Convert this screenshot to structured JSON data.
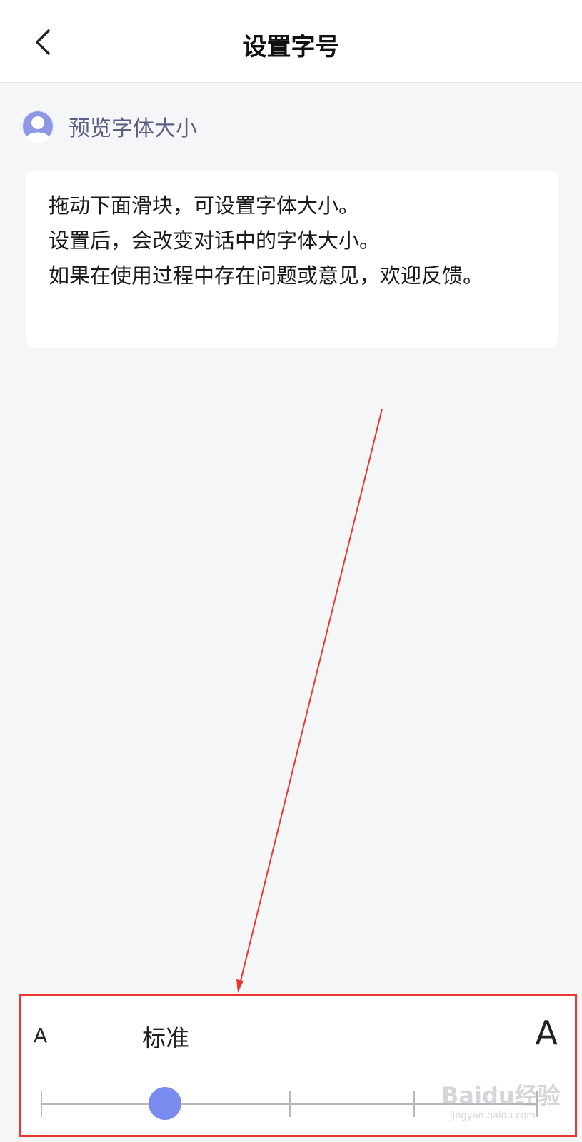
{
  "header": {
    "title": "设置字号"
  },
  "preview": {
    "label": "预览字体大小"
  },
  "message": {
    "lines": [
      "拖动下面滑块，可设置字体大小。",
      "设置后，会改变对话中的字体大小。",
      "如果在使用过程中存在问题或意见，欢迎反馈。"
    ]
  },
  "font_slider": {
    "small_label": "A",
    "current_label": "标准",
    "large_label": "A",
    "levels": 5,
    "selected_index": 1
  },
  "colors": {
    "accent": "#7a8bef",
    "annotation": "#e8382f",
    "preview_label": "#5d5f82"
  },
  "watermark": {
    "brand": "Baidu经验",
    "url": "jingyan.baidu.com"
  }
}
